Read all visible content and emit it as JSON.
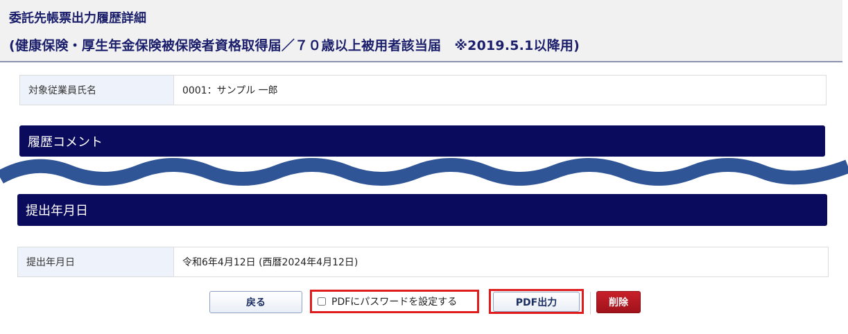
{
  "header": {
    "title_line1": "委託先帳票出力履歴詳細",
    "title_line2": "(健康保険・厚生年金保険被保険者資格取得届／７０歳以上被用者該当届　※2019.5.1以降用)"
  },
  "employee": {
    "label": "対象従業員氏名",
    "value": "0001：サンプル 一郎"
  },
  "sections": {
    "comment_title": "履歴コメント",
    "submission_title": "提出年月日"
  },
  "submission": {
    "label": "提出年月日",
    "value": "令和6年4月12日 (西暦2024年4月12日)"
  },
  "actions": {
    "back_label": "戻る",
    "pdf_password_label": "PDFにパスワードを設定する",
    "pdf_password_checked": false,
    "pdf_output_label": "PDF出力",
    "delete_label": "削除"
  },
  "colors": {
    "section_bar": "#0b0b5e",
    "highlight": "#e01c1c",
    "wave": "#2f5596",
    "delete_button": "#b0161f"
  }
}
